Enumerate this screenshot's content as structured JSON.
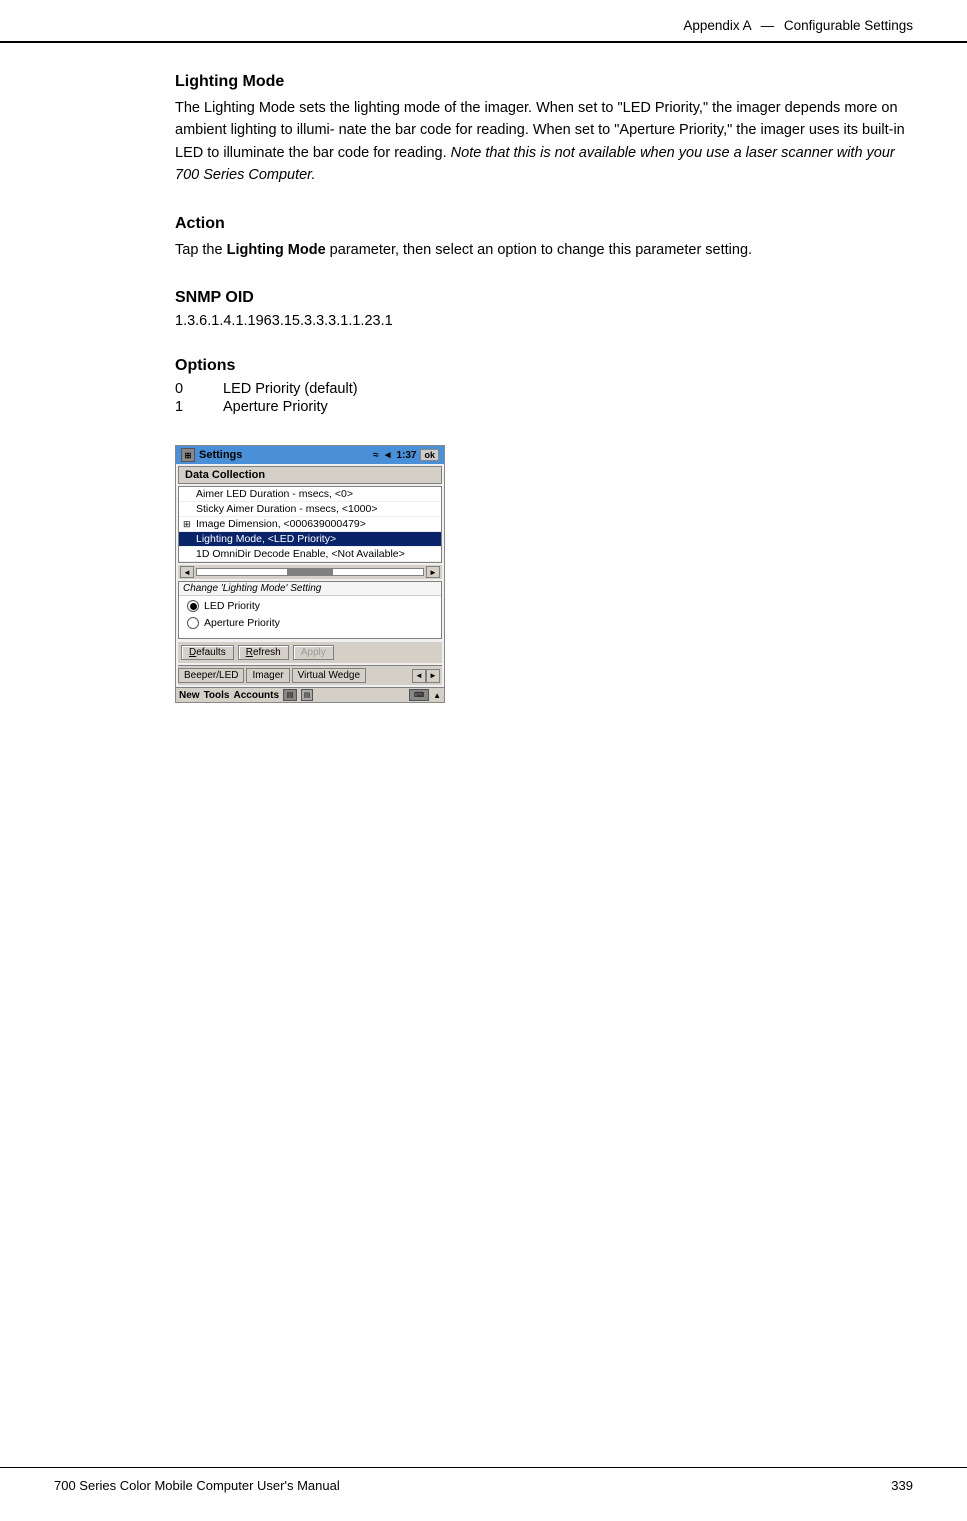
{
  "header": {
    "appendix": "Appendix A",
    "em_dash": "—",
    "chapter": "Configurable Settings"
  },
  "footer": {
    "left": "700 Series Color Mobile Computer User's Manual",
    "right": "339"
  },
  "sections": [
    {
      "id": "lighting-mode",
      "title": "Lighting Mode",
      "body_parts": [
        "The Lighting Mode sets the lighting mode of the imager. When set to “LED Priority,” the imager depends more on ambient lighting to illumi-nate the bar code for reading. When set to “Aperture Priority,” the imager uses its built-in LED to illuminate the bar code for reading. ",
        "Note that this is not available when you use a laser scanner with your 700 Series Computer."
      ]
    },
    {
      "id": "action",
      "title": "Action",
      "body": "Tap the ",
      "bold_word": "Lighting Mode",
      "body_end": " parameter, then select an option to change this parameter setting."
    },
    {
      "id": "snmp-oid",
      "title": "SNMP OID",
      "value": "1.3.6.1.4.1.1963.15.3.3.3.1.1.23.1"
    },
    {
      "id": "options",
      "title": "Options",
      "items": [
        {
          "num": "0",
          "label": "LED Priority (default)"
        },
        {
          "num": "1",
          "label": "Aperture Priority"
        }
      ]
    }
  ],
  "device": {
    "titlebar": {
      "icon_label": "⊞",
      "app_name": "Settings",
      "signal_icon": "📶",
      "volume_icon": "🔊",
      "time": "1:37",
      "ok_label": "ok"
    },
    "data_collection_label": "Data Collection",
    "list_items": [
      {
        "text": "Aimer LED Duration - msecs, <0>",
        "expand": "",
        "selected": false
      },
      {
        "text": "Sticky Aimer Duration - msecs, <1000>",
        "expand": "",
        "selected": false
      },
      {
        "text": "Image Dimension, <000639000479>",
        "expand": "⊞",
        "selected": false
      },
      {
        "text": "Lighting Mode, <LED Priority>",
        "expand": "",
        "selected": true
      },
      {
        "text": "1D OmniDir Decode Enable, <Not Available>",
        "expand": "",
        "selected": false
      }
    ],
    "change_setting_title": "Change 'Lighting Mode' Setting",
    "radio_options": [
      {
        "label": "LED Priority",
        "selected": true
      },
      {
        "label": "Aperture Priority",
        "selected": false
      }
    ],
    "buttons": [
      {
        "label": "Defaults",
        "underline": "D",
        "disabled": false
      },
      {
        "label": "Refresh",
        "underline": "R",
        "disabled": false
      },
      {
        "label": "Apply",
        "underline": "A",
        "disabled": true
      }
    ],
    "tabs": [
      {
        "label": "Beeper/LED",
        "active": false
      },
      {
        "label": "Imager",
        "active": false
      },
      {
        "label": "Virtual Wedge",
        "active": false
      }
    ],
    "taskbar_items": [
      "New",
      "Tools",
      "Accounts"
    ]
  }
}
